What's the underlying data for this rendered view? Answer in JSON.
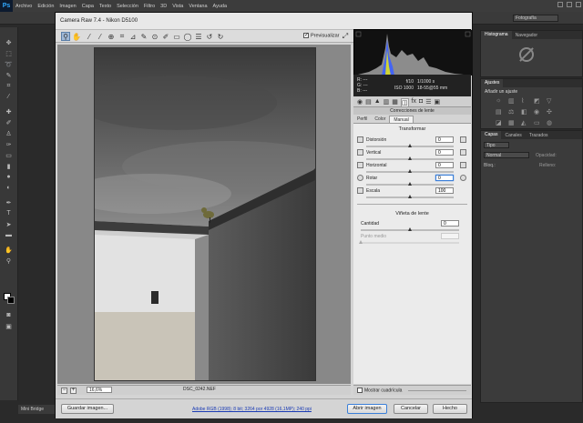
{
  "app": {
    "logo": "Ps",
    "menu": [
      "Archivo",
      "Edición",
      "Imagen",
      "Capa",
      "Texto",
      "Selección",
      "Filtro",
      "3D",
      "Vista",
      "Ventana",
      "Ayuda"
    ],
    "workspace": "Fotografía"
  },
  "right_panels": {
    "histogram_tabs": [
      "Histograma",
      "Navegador"
    ],
    "adjustments_tab": "Ajustes",
    "adjustments_subtitle": "Añadir un ajuste",
    "layers_tabs": [
      "Capas",
      "Canales",
      "Trazados"
    ],
    "layers_kind": "Tipo",
    "blend_mode": "Normal",
    "opacity_label": "Opacidad:",
    "lock_label": "Bloq.:",
    "fill_label": "Relleno:"
  },
  "mini_bridge": "Mini Bridge",
  "dialog": {
    "title": "Camera Raw 7.4 - Nikon D5100",
    "preview_label": "Previsualizar",
    "camera_info": {
      "r": "R:",
      "g": "G:",
      "b": "B:",
      "dashes": "---",
      "aperture": "f/10",
      "shutter": "1/1000 s",
      "iso": "ISO 1000",
      "lens": "18-55@55 mm"
    },
    "section_title": "Correcciones de lente",
    "subtabs": [
      "Perfil",
      "Color",
      "Manual"
    ],
    "transform_title": "Transformar",
    "transform_sliders": [
      {
        "label": "Distorsión",
        "value": "0",
        "pos": 0.5
      },
      {
        "label": "Vertical",
        "value": "0",
        "pos": 0.5
      },
      {
        "label": "Horizontal",
        "value": "0",
        "pos": 0.5
      },
      {
        "label": "Rotar",
        "value": "0",
        "pos": 0.5
      },
      {
        "label": "Escala",
        "value": "100",
        "pos": 0.5
      }
    ],
    "vignette_title": "Viñeta de lente",
    "vignette_sliders": [
      {
        "label": "Cantidad",
        "value": "0",
        "pos": 0.5
      },
      {
        "label": "Punto medio",
        "value": "",
        "pos": 0.0
      }
    ],
    "zoom": "16,6%",
    "filename": "DSC_0242.NEF",
    "show_grid": "Mostrar cuadrícula",
    "workflow": "Adobe RGB (1998); 8 bit; 3264 por 4928 (16,1MP); 240 ppi",
    "buttons": {
      "save": "Guardar imagen...",
      "open": "Abrir imagen",
      "cancel": "Cancelar",
      "done": "Hecho"
    }
  }
}
